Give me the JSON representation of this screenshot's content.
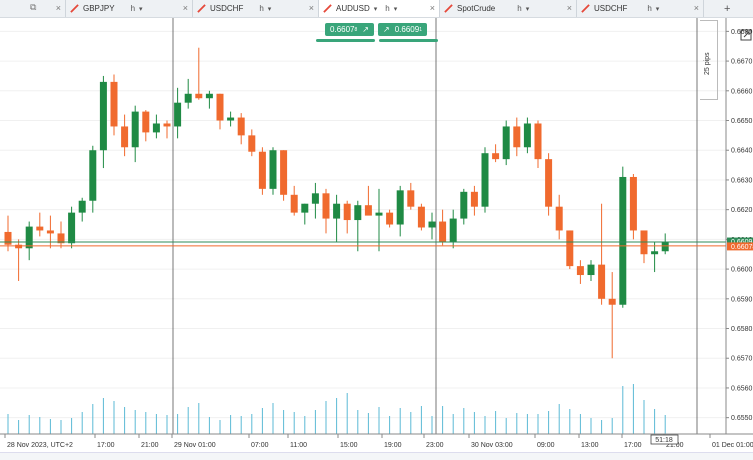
{
  "tabs": [
    {
      "label": "",
      "timeframe": "",
      "active": false
    },
    {
      "label": "GBPJPY",
      "timeframe": "h",
      "active": false
    },
    {
      "label": "USDCHF",
      "timeframe": "h",
      "active": false
    },
    {
      "label": "AUDUSD",
      "timeframe": "h",
      "active": true
    },
    {
      "label": "SpotCrude",
      "timeframe": "h",
      "active": false
    },
    {
      "label": "USDCHF",
      "timeframe": "h",
      "active": false
    }
  ],
  "trade": {
    "sell_price": "0.6607",
    "sell_sup": "8",
    "buy_price": "0.6609",
    "buy_sup": "1",
    "color": "#39a57a"
  },
  "pips_label": "25 pips",
  "colors": {
    "bull": "#1f8a44",
    "bear": "#f06a2e",
    "volume": "#5bbad5",
    "bid_line": "#2e8b57",
    "ask_line": "#f06a2e"
  },
  "chart_data": {
    "type": "candlestick",
    "symbol": "AUDUSD",
    "timeframe": "H1",
    "y_ticks": [
      "0.6680",
      "0.6670",
      "0.6660",
      "0.6650",
      "0.6640",
      "0.6630",
      "0.6620",
      "0.6610",
      "0.6600",
      "0.6590",
      "0.6580",
      "0.6570",
      "0.6560",
      "0.6550"
    ],
    "ylim": [
      0.65445,
      0.66845
    ],
    "current_bid": "0.66078",
    "current_ask": "0.66091",
    "time_labels": [
      "28 Nov 2023, UTC+2",
      "17:00",
      "21:00",
      "29 Nov 01:00",
      "07:00",
      "11:00",
      "15:00",
      "19:00",
      "23:00",
      "30 Nov 03:00",
      "09:00",
      "13:00",
      "17:00",
      "21:00",
      "01 Dec 01:00"
    ],
    "crosshair_time": "51:18",
    "candles": [
      {
        "o": 0.66125,
        "h": 0.6618,
        "l": 0.6606,
        "c": 0.66082
      },
      {
        "o": 0.66082,
        "h": 0.661,
        "l": 0.6596,
        "c": 0.6607
      },
      {
        "o": 0.6607,
        "h": 0.6616,
        "l": 0.6603,
        "c": 0.66143
      },
      {
        "o": 0.66143,
        "h": 0.6619,
        "l": 0.6611,
        "c": 0.6613
      },
      {
        "o": 0.6613,
        "h": 0.6618,
        "l": 0.6607,
        "c": 0.6612
      },
      {
        "o": 0.6612,
        "h": 0.6616,
        "l": 0.6607,
        "c": 0.66087
      },
      {
        "o": 0.66087,
        "h": 0.6621,
        "l": 0.6607,
        "c": 0.6619
      },
      {
        "o": 0.6619,
        "h": 0.6624,
        "l": 0.6616,
        "c": 0.6623
      },
      {
        "o": 0.6623,
        "h": 0.66415,
        "l": 0.6619,
        "c": 0.664
      },
      {
        "o": 0.664,
        "h": 0.6665,
        "l": 0.6634,
        "c": 0.6663
      },
      {
        "o": 0.6663,
        "h": 0.66655,
        "l": 0.6645,
        "c": 0.6648
      },
      {
        "o": 0.6648,
        "h": 0.6652,
        "l": 0.6638,
        "c": 0.6641
      },
      {
        "o": 0.6641,
        "h": 0.6655,
        "l": 0.6636,
        "c": 0.6653
      },
      {
        "o": 0.6653,
        "h": 0.66535,
        "l": 0.6643,
        "c": 0.6646
      },
      {
        "o": 0.6646,
        "h": 0.6652,
        "l": 0.6644,
        "c": 0.6649
      },
      {
        "o": 0.6649,
        "h": 0.665,
        "l": 0.6644,
        "c": 0.6648
      },
      {
        "o": 0.6648,
        "h": 0.6661,
        "l": 0.6644,
        "c": 0.6656
      },
      {
        "o": 0.6656,
        "h": 0.6664,
        "l": 0.6654,
        "c": 0.6659
      },
      {
        "o": 0.6659,
        "h": 0.66745,
        "l": 0.6657,
        "c": 0.66575
      },
      {
        "o": 0.66575,
        "h": 0.666,
        "l": 0.6654,
        "c": 0.6659
      },
      {
        "o": 0.6659,
        "h": 0.6659,
        "l": 0.6647,
        "c": 0.665
      },
      {
        "o": 0.665,
        "h": 0.6653,
        "l": 0.6648,
        "c": 0.6651
      },
      {
        "o": 0.6651,
        "h": 0.66525,
        "l": 0.6642,
        "c": 0.6645
      },
      {
        "o": 0.6645,
        "h": 0.6647,
        "l": 0.6638,
        "c": 0.66395
      },
      {
        "o": 0.66395,
        "h": 0.6641,
        "l": 0.6625,
        "c": 0.6627
      },
      {
        "o": 0.6627,
        "h": 0.6641,
        "l": 0.6625,
        "c": 0.664
      },
      {
        "o": 0.664,
        "h": 0.664,
        "l": 0.6623,
        "c": 0.6625
      },
      {
        "o": 0.6625,
        "h": 0.6628,
        "l": 0.6618,
        "c": 0.6619
      },
      {
        "o": 0.6619,
        "h": 0.6622,
        "l": 0.6615,
        "c": 0.6622
      },
      {
        "o": 0.6622,
        "h": 0.6629,
        "l": 0.6617,
        "c": 0.66255
      },
      {
        "o": 0.66255,
        "h": 0.6627,
        "l": 0.6612,
        "c": 0.6617
      },
      {
        "o": 0.6617,
        "h": 0.6625,
        "l": 0.6609,
        "c": 0.6622
      },
      {
        "o": 0.6622,
        "h": 0.6623,
        "l": 0.6612,
        "c": 0.66165
      },
      {
        "o": 0.66165,
        "h": 0.6623,
        "l": 0.6606,
        "c": 0.66215
      },
      {
        "o": 0.66215,
        "h": 0.6628,
        "l": 0.6619,
        "c": 0.6618
      },
      {
        "o": 0.6618,
        "h": 0.6627,
        "l": 0.6606,
        "c": 0.6619
      },
      {
        "o": 0.6619,
        "h": 0.662,
        "l": 0.6614,
        "c": 0.6615
      },
      {
        "o": 0.6615,
        "h": 0.6628,
        "l": 0.6611,
        "c": 0.66265
      },
      {
        "o": 0.66265,
        "h": 0.6629,
        "l": 0.662,
        "c": 0.6621
      },
      {
        "o": 0.6621,
        "h": 0.6622,
        "l": 0.6613,
        "c": 0.6614
      },
      {
        "o": 0.6614,
        "h": 0.6619,
        "l": 0.661,
        "c": 0.6616
      },
      {
        "o": 0.6616,
        "h": 0.662,
        "l": 0.6608,
        "c": 0.6609
      },
      {
        "o": 0.6609,
        "h": 0.662,
        "l": 0.6607,
        "c": 0.6617
      },
      {
        "o": 0.6617,
        "h": 0.6627,
        "l": 0.6615,
        "c": 0.6626
      },
      {
        "o": 0.6626,
        "h": 0.6628,
        "l": 0.6618,
        "c": 0.6621
      },
      {
        "o": 0.6621,
        "h": 0.6641,
        "l": 0.6619,
        "c": 0.6639
      },
      {
        "o": 0.6639,
        "h": 0.6642,
        "l": 0.6636,
        "c": 0.6637
      },
      {
        "o": 0.6637,
        "h": 0.665,
        "l": 0.6635,
        "c": 0.6648
      },
      {
        "o": 0.6648,
        "h": 0.6651,
        "l": 0.6638,
        "c": 0.6641
      },
      {
        "o": 0.6641,
        "h": 0.6651,
        "l": 0.6639,
        "c": 0.6649
      },
      {
        "o": 0.6649,
        "h": 0.665,
        "l": 0.6634,
        "c": 0.6637
      },
      {
        "o": 0.6637,
        "h": 0.6639,
        "l": 0.6618,
        "c": 0.6621
      },
      {
        "o": 0.6621,
        "h": 0.6625,
        "l": 0.661,
        "c": 0.6613
      },
      {
        "o": 0.6613,
        "h": 0.6613,
        "l": 0.66,
        "c": 0.6601
      },
      {
        "o": 0.6601,
        "h": 0.6603,
        "l": 0.6595,
        "c": 0.6598
      },
      {
        "o": 0.6598,
        "h": 0.6603,
        "l": 0.6596,
        "c": 0.66015
      },
      {
        "o": 0.66015,
        "h": 0.6622,
        "l": 0.6588,
        "c": 0.659
      },
      {
        "o": 0.659,
        "h": 0.6599,
        "l": 0.657,
        "c": 0.6588
      },
      {
        "o": 0.6588,
        "h": 0.66345,
        "l": 0.6587,
        "c": 0.6631
      },
      {
        "o": 0.6631,
        "h": 0.6632,
        "l": 0.661,
        "c": 0.6613
      },
      {
        "o": 0.6613,
        "h": 0.6613,
        "l": 0.6602,
        "c": 0.6605
      },
      {
        "o": 0.6605,
        "h": 0.6609,
        "l": 0.6599,
        "c": 0.6606
      },
      {
        "o": 0.6606,
        "h": 0.6612,
        "l": 0.6605,
        "c": 0.6609
      }
    ],
    "volume": [
      20,
      14,
      19,
      17,
      15,
      14,
      16,
      22,
      30,
      36,
      33,
      27,
      24,
      22,
      20,
      19,
      20,
      27,
      31,
      17,
      14,
      19,
      18,
      20,
      26,
      31,
      24,
      22,
      18,
      24,
      33,
      36,
      41,
      24,
      21,
      27,
      18,
      26,
      22,
      28,
      18,
      28,
      20,
      26,
      22,
      18,
      23,
      16,
      21,
      20,
      20,
      23,
      30,
      25,
      20,
      16,
      14,
      16,
      48,
      50,
      34,
      25,
      19
    ]
  }
}
